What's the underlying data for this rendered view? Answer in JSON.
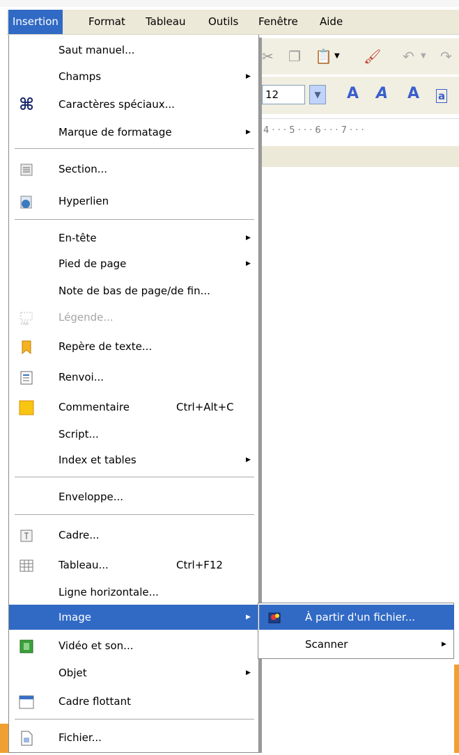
{
  "menubar": {
    "items": [
      "Insertion",
      "Format",
      "Tableau",
      "Outils",
      "Fenêtre",
      "Aide"
    ]
  },
  "toolbar": {
    "font_size": "12"
  },
  "ruler": "4 · · · 5 · · · 6 · · · 7 · · ·",
  "menu": {
    "saut_manuel": "Saut manuel...",
    "champs": "Champs",
    "caracteres_speciaux": "Caractères spéciaux...",
    "marque_formatage": "Marque de formatage",
    "section": "Section...",
    "hyperlien": "Hyperlien",
    "en_tete": "En-tête",
    "pied_de_page": "Pied de page",
    "note_bas_page": "Note de bas de page/de fin...",
    "legende": "Légende...",
    "repere_texte": "Repère de texte...",
    "renvoi": "Renvoi...",
    "commentaire": "Commentaire",
    "commentaire_shortcut": "Ctrl+Alt+C",
    "script": "Script...",
    "index_tables": "Index et tables",
    "enveloppe": "Enveloppe...",
    "cadre": "Cadre...",
    "tableau": "Tableau...",
    "tableau_shortcut": "Ctrl+F12",
    "ligne_horizontale": "Ligne horizontale...",
    "image": "Image",
    "video_son": "Vidéo et son...",
    "objet": "Objet",
    "cadre_flottant": "Cadre flottant",
    "fichier": "Fichier..."
  },
  "submenu": {
    "a_partir_fichier": "À partir d'un fichier...",
    "scanner": "Scanner"
  },
  "icons": {
    "caracteres_speciaux": "command-key-icon",
    "section": "section-icon",
    "hyperlien": "hyperlink-globe-icon",
    "legende": "caption-icon",
    "repere_texte": "bookmark-icon",
    "renvoi": "cross-reference-icon",
    "commentaire": "note-icon",
    "cadre": "frame-icon",
    "tableau": "table-icon",
    "video_son": "film-icon",
    "cadre_flottant": "floating-frame-icon",
    "fichier": "document-icon",
    "a_partir_fichier": "image-from-file-icon"
  },
  "colors": {
    "highlight": "#316ac5",
    "menubar": "#ece9d8",
    "disabled_text": "#a5a5a5"
  }
}
